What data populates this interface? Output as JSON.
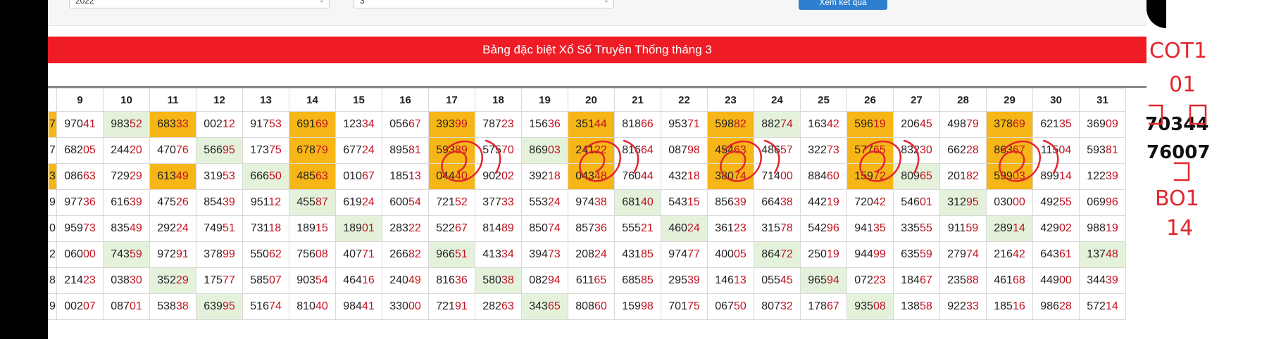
{
  "filter": {
    "year_value": "2022",
    "month_value": "3",
    "view_button": "Xem kết quả"
  },
  "banner": {
    "title": "Bảng đặc biệt Xổ Số Truyền Thống tháng 3"
  },
  "columns": [
    "",
    "9",
    "10",
    "11",
    "12",
    "13",
    "14",
    "15",
    "16",
    "17",
    "18",
    "19",
    "20",
    "21",
    "22",
    "23",
    "24",
    "25",
    "26",
    "27",
    "28",
    "29",
    "30",
    "31"
  ],
  "rows": [
    [
      [
        "7",
        "y"
      ],
      [
        "97041",
        ""
      ],
      [
        "98352",
        "g"
      ],
      [
        "68333",
        "y"
      ],
      [
        "00212",
        ""
      ],
      [
        "91753",
        ""
      ],
      [
        "69169",
        "y"
      ],
      [
        "12334",
        ""
      ],
      [
        "05667",
        ""
      ],
      [
        "39399",
        "y"
      ],
      [
        "78723",
        ""
      ],
      [
        "15636",
        ""
      ],
      [
        "35144",
        "y"
      ],
      [
        "81866",
        ""
      ],
      [
        "95371",
        ""
      ],
      [
        "59882",
        "y"
      ],
      [
        "88274",
        "g"
      ],
      [
        "16342",
        ""
      ],
      [
        "59619",
        "y"
      ],
      [
        "20645",
        ""
      ],
      [
        "49879",
        ""
      ],
      [
        "37869",
        "y"
      ],
      [
        "62135",
        ""
      ],
      [
        "36909",
        ""
      ]
    ],
    [
      [
        "7",
        ""
      ],
      [
        "68205",
        ""
      ],
      [
        "24420",
        ""
      ],
      [
        "47076",
        ""
      ],
      [
        "56695",
        "g"
      ],
      [
        "17375",
        ""
      ],
      [
        "67879",
        "y"
      ],
      [
        "67724",
        ""
      ],
      [
        "89581",
        ""
      ],
      [
        "59389",
        "y"
      ],
      [
        "57570",
        ""
      ],
      [
        "86903",
        "g"
      ],
      [
        "24122",
        "y"
      ],
      [
        "81664",
        ""
      ],
      [
        "08798",
        ""
      ],
      [
        "45463",
        "y"
      ],
      [
        "48657",
        ""
      ],
      [
        "32273",
        ""
      ],
      [
        "57765",
        "y"
      ],
      [
        "83230",
        ""
      ],
      [
        "66228",
        ""
      ],
      [
        "86367",
        "y"
      ],
      [
        "11504",
        ""
      ],
      [
        "59381",
        ""
      ]
    ],
    [
      [
        "3",
        "y"
      ],
      [
        "08663",
        ""
      ],
      [
        "72929",
        ""
      ],
      [
        "61349",
        "y"
      ],
      [
        "31953",
        ""
      ],
      [
        "66650",
        "g"
      ],
      [
        "48563",
        "y"
      ],
      [
        "01067",
        ""
      ],
      [
        "18513",
        ""
      ],
      [
        "04440",
        "y"
      ],
      [
        "90202",
        ""
      ],
      [
        "39218",
        ""
      ],
      [
        "04348",
        "y"
      ],
      [
        "76044",
        ""
      ],
      [
        "43218",
        ""
      ],
      [
        "38074",
        "y"
      ],
      [
        "71400",
        ""
      ],
      [
        "88460",
        ""
      ],
      [
        "15972",
        "y"
      ],
      [
        "80965",
        "g"
      ],
      [
        "20182",
        ""
      ],
      [
        "59903",
        "y"
      ],
      [
        "89914",
        ""
      ],
      [
        "12239",
        ""
      ]
    ],
    [
      [
        "9",
        ""
      ],
      [
        "97736",
        ""
      ],
      [
        "61639",
        ""
      ],
      [
        "47526",
        ""
      ],
      [
        "85439",
        ""
      ],
      [
        "95112",
        ""
      ],
      [
        "45587",
        "g"
      ],
      [
        "61924",
        ""
      ],
      [
        "60054",
        ""
      ],
      [
        "72152",
        ""
      ],
      [
        "37733",
        ""
      ],
      [
        "55324",
        ""
      ],
      [
        "97438",
        ""
      ],
      [
        "68140",
        "g"
      ],
      [
        "54315",
        ""
      ],
      [
        "85639",
        ""
      ],
      [
        "66438",
        ""
      ],
      [
        "44219",
        ""
      ],
      [
        "72042",
        ""
      ],
      [
        "54601",
        ""
      ],
      [
        "31295",
        "g"
      ],
      [
        "03000",
        ""
      ],
      [
        "49255",
        ""
      ],
      [
        "06996",
        ""
      ]
    ],
    [
      [
        "0",
        ""
      ],
      [
        "95973",
        ""
      ],
      [
        "83549",
        ""
      ],
      [
        "29224",
        ""
      ],
      [
        "74951",
        ""
      ],
      [
        "73118",
        ""
      ],
      [
        "18915",
        ""
      ],
      [
        "18901",
        "g"
      ],
      [
        "28322",
        ""
      ],
      [
        "52267",
        ""
      ],
      [
        "81489",
        ""
      ],
      [
        "85074",
        ""
      ],
      [
        "85736",
        ""
      ],
      [
        "55521",
        ""
      ],
      [
        "46024",
        "g"
      ],
      [
        "36123",
        ""
      ],
      [
        "31578",
        ""
      ],
      [
        "54296",
        ""
      ],
      [
        "94135",
        ""
      ],
      [
        "33555",
        ""
      ],
      [
        "91159",
        ""
      ],
      [
        "28914",
        "g"
      ],
      [
        "42902",
        ""
      ],
      [
        "98819",
        ""
      ]
    ],
    [
      [
        "2",
        ""
      ],
      [
        "06000",
        ""
      ],
      [
        "74359",
        "g"
      ],
      [
        "97291",
        ""
      ],
      [
        "37899",
        ""
      ],
      [
        "55062",
        ""
      ],
      [
        "75608",
        ""
      ],
      [
        "40771",
        ""
      ],
      [
        "26682",
        ""
      ],
      [
        "96651",
        "g"
      ],
      [
        "41334",
        ""
      ],
      [
        "39473",
        ""
      ],
      [
        "20824",
        ""
      ],
      [
        "43185",
        ""
      ],
      [
        "97477",
        ""
      ],
      [
        "40005",
        ""
      ],
      [
        "86472",
        "g"
      ],
      [
        "25019",
        ""
      ],
      [
        "94499",
        ""
      ],
      [
        "63559",
        ""
      ],
      [
        "27974",
        ""
      ],
      [
        "21642",
        ""
      ],
      [
        "64361",
        ""
      ],
      [
        "13748",
        "g"
      ]
    ],
    [
      [
        "8",
        ""
      ],
      [
        "21423",
        ""
      ],
      [
        "03830",
        ""
      ],
      [
        "35229",
        "g"
      ],
      [
        "17577",
        ""
      ],
      [
        "58507",
        ""
      ],
      [
        "90354",
        ""
      ],
      [
        "46416",
        ""
      ],
      [
        "24049",
        ""
      ],
      [
        "81636",
        ""
      ],
      [
        "58038",
        "g"
      ],
      [
        "08294",
        ""
      ],
      [
        "61165",
        ""
      ],
      [
        "68585",
        ""
      ],
      [
        "29539",
        ""
      ],
      [
        "14613",
        ""
      ],
      [
        "05545",
        ""
      ],
      [
        "96594",
        "g"
      ],
      [
        "07223",
        ""
      ],
      [
        "18467",
        ""
      ],
      [
        "23588",
        ""
      ],
      [
        "46168",
        ""
      ],
      [
        "44900",
        ""
      ],
      [
        "34439",
        ""
      ]
    ],
    [
      [
        "9",
        ""
      ],
      [
        "00207",
        ""
      ],
      [
        "08701",
        ""
      ],
      [
        "53838",
        ""
      ],
      [
        "63995",
        "g"
      ],
      [
        "51674",
        ""
      ],
      [
        "81040",
        ""
      ],
      [
        "98441",
        ""
      ],
      [
        "33000",
        ""
      ],
      [
        "72191",
        ""
      ],
      [
        "28263",
        ""
      ],
      [
        "34365",
        "g"
      ],
      [
        "80860",
        ""
      ],
      [
        "15998",
        ""
      ],
      [
        "70175",
        ""
      ],
      [
        "06750",
        ""
      ],
      [
        "80732",
        ""
      ],
      [
        "17867",
        ""
      ],
      [
        "93508",
        "g"
      ],
      [
        "13858",
        ""
      ],
      [
        "92233",
        ""
      ],
      [
        "18516",
        ""
      ],
      [
        "98628",
        ""
      ],
      [
        "57214",
        ""
      ]
    ]
  ],
  "annotations": {
    "cot_label": "COT1",
    "cot_value": "01",
    "num_a": "70344",
    "num_b": "76007",
    "bo_label": "BO1",
    "bo_value": "14"
  },
  "colors": {
    "banner": "#ef1c26",
    "highlight_yellow": "#f7b617",
    "highlight_green": "#e4f2dc",
    "tail_red": "#c1121f",
    "ink_red": "#e3262d"
  }
}
